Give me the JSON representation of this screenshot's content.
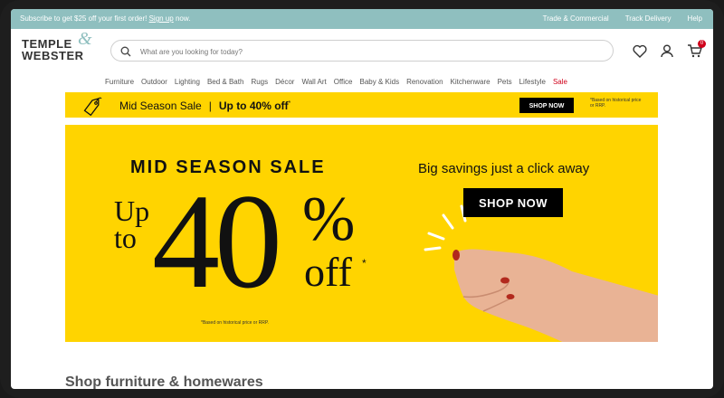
{
  "topbar": {
    "promo_prefix": "Subscribe to get $25 off your first order! ",
    "promo_link": "Sign up",
    "promo_suffix": " now.",
    "links": [
      "Trade & Commercial",
      "Track Delivery",
      "Help"
    ]
  },
  "header": {
    "logo_line1": "TEMPLE",
    "logo_amp": "&",
    "logo_line2": "WEBSTER",
    "search_placeholder": "What are you looking for today?",
    "cart_count": "0"
  },
  "nav": {
    "items": [
      "Furniture",
      "Outdoor",
      "Lighting",
      "Bed & Bath",
      "Rugs",
      "Décor",
      "Wall Art",
      "Office",
      "Baby & Kids",
      "Renovation",
      "Kitchenware",
      "Pets",
      "Lifestyle"
    ],
    "sale": "Sale"
  },
  "strip": {
    "label": "Mid Season Sale",
    "separator": "|",
    "offer": "Up to 40% off",
    "asterisk": "*",
    "button": "SHOP NOW",
    "fine_print": "*Based on historical price or RRP."
  },
  "hero": {
    "title": "MID SEASON SALE",
    "up": "Up",
    "to": "to",
    "number": "40",
    "percent": "%",
    "off": "off",
    "asterisk": "*",
    "note": "*Based on historical price or RRP.",
    "tagline": "Big savings just a click away",
    "button": "SHOP NOW"
  },
  "section": {
    "title": "Shop furniture & homewares"
  },
  "colors": {
    "topbar": "#8fbfbf",
    "accent_yellow": "#ffd400",
    "sale_red": "#d0021b"
  }
}
